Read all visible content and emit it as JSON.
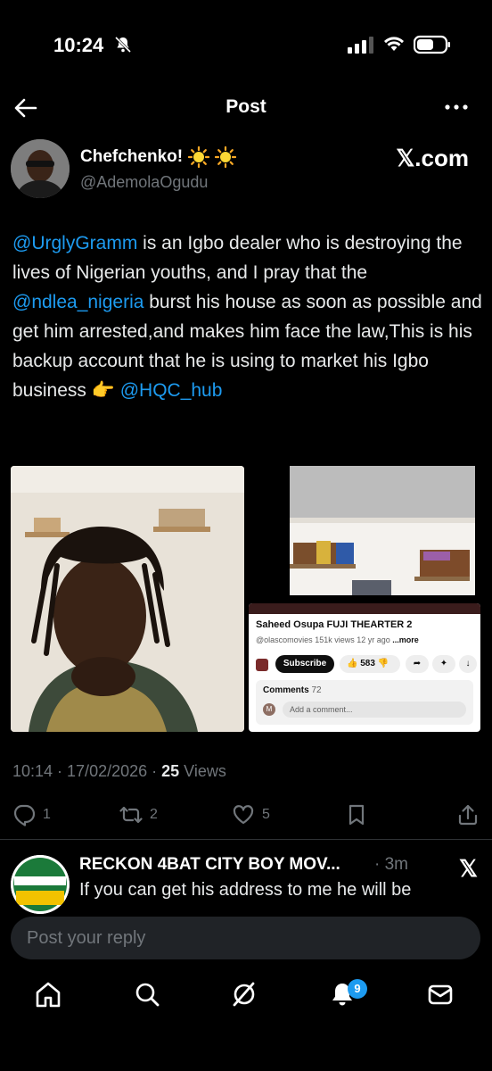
{
  "status_bar": {
    "time": "10:24"
  },
  "header": {
    "title": "Post"
  },
  "author": {
    "name": "Chefchenko!",
    "handle": "@AdemolaOgudu"
  },
  "brand": {
    "watermark": "𝕏.com"
  },
  "post": {
    "mention1": "@UrglyGramm",
    "text1": " is an Igbo dealer who is destroying the lives of Nigerian youths, and I pray that the ",
    "mention2": "@ndlea_nigeria",
    "text2": " burst his house as soon as possible and get him arrested,and makes him face the law,This is his backup account that he is using to market his Igbo business ",
    "emoji": "👉",
    "mention3": "@HQC_hub"
  },
  "youtube": {
    "title": "Saheed Osupa FUJI THEARTER 2",
    "channel": "@olascomovies",
    "meta": "151k views  12 yr ago",
    "more": "...more",
    "subscribe": "Subscribe",
    "likes": "583",
    "comments_label": "Comments",
    "comments_count": "72",
    "avatar_letter": "M",
    "add_comment": "Add a comment..."
  },
  "meta": {
    "time": "10:14 · 17/02/2026 · ",
    "views": "25",
    "views_label": " Views"
  },
  "actions": {
    "replies": "1",
    "reposts": "2",
    "likes": "5"
  },
  "reply": {
    "name": "RECKON 4BAT CITY BOY MOV...",
    "time": "· 3m",
    "text": "If you can get his address to me he will be",
    "x": "𝕏"
  },
  "reply_input": {
    "placeholder": "Post your reply"
  },
  "nav": {
    "notifications_badge": "9"
  },
  "colors": {
    "accent": "#1d9bf0",
    "background": "#000000",
    "muted": "#71767b"
  }
}
